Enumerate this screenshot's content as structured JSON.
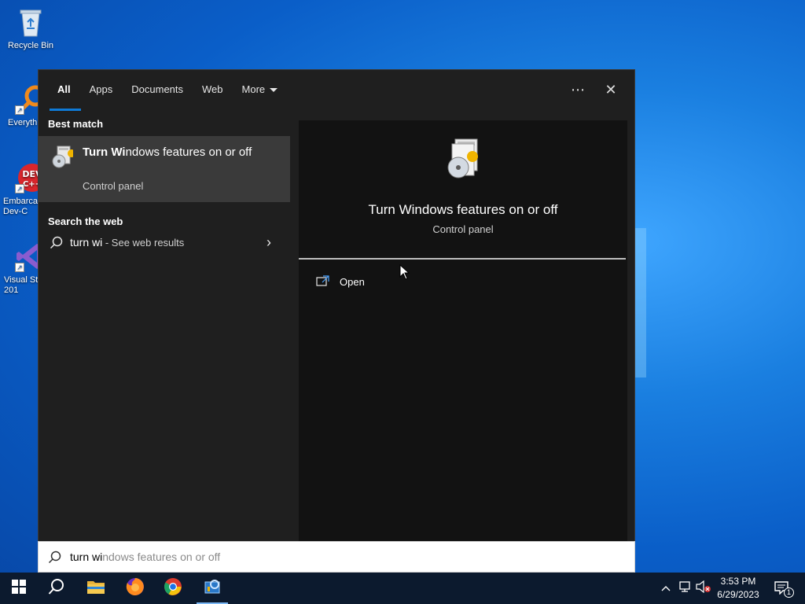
{
  "desktop": {
    "icons": [
      {
        "label": "Recycle Bin",
        "icon": "recycle-bin-icon"
      },
      {
        "label": "Everyth",
        "icon": "everything-search-icon"
      },
      {
        "label": "Embarca Dev-C",
        "icon": "devcpp-icon"
      },
      {
        "label": "Visual St 201",
        "icon": "visual-studio-icon"
      }
    ]
  },
  "search_panel": {
    "tabs": [
      {
        "label": "All",
        "active": true
      },
      {
        "label": "Apps"
      },
      {
        "label": "Documents"
      },
      {
        "label": "Web"
      },
      {
        "label": "More"
      }
    ],
    "more_glyph": "⋯",
    "close_glyph": "✕",
    "best_match_heading": "Best match",
    "best_match": {
      "title_bold": "Turn Wi",
      "title_rest": "ndows features on or off",
      "subtitle": "Control panel"
    },
    "web_heading": "Search the web",
    "web_result": {
      "query": "turn wi",
      "suffix": " - See web results",
      "chevron": "›"
    },
    "detail": {
      "title": "Turn Windows features on or off",
      "subtitle": "Control panel",
      "action_open": "Open"
    }
  },
  "search_box": {
    "typed": "turn wi",
    "completion": "ndows features on or off"
  },
  "taskbar": {
    "apps": [
      {
        "name": "start-button",
        "icon": "windows-logo-icon"
      },
      {
        "name": "search-button",
        "icon": "search-icon"
      },
      {
        "name": "file-explorer",
        "icon": "folder-icon"
      },
      {
        "name": "firefox",
        "icon": "firefox-icon"
      },
      {
        "name": "chrome",
        "icon": "chrome-icon"
      },
      {
        "name": "control-panel",
        "icon": "control-panel-icon",
        "active": true
      }
    ],
    "clock_time": "3:53 PM",
    "clock_date": "6/29/2023",
    "notification_count": "1"
  },
  "colors": {
    "accent": "#0f7ad6",
    "panel_bg": "#1f1f1f",
    "detail_bg": "#121212",
    "selected_bg": "#3a3a3a",
    "taskbar_bg": "#0c1a2e"
  }
}
